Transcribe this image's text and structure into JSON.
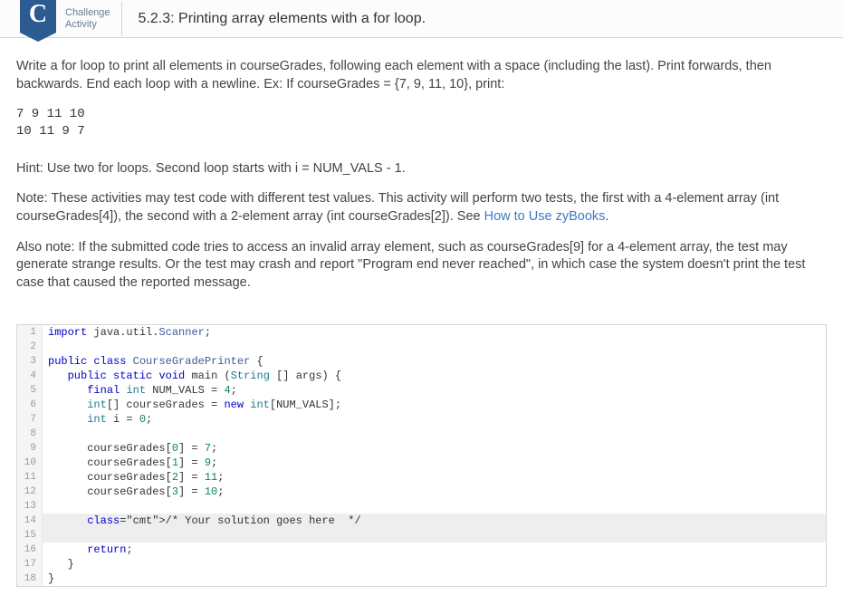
{
  "header": {
    "badge_letter": "C",
    "badge_label_line1": "Challenge",
    "badge_label_line2": "Activity",
    "title": "5.2.3: Printing array elements with a for loop."
  },
  "instructions": {
    "p1": "Write a for loop to print all elements in courseGrades, following each element with a space (including the last). Print forwards, then backwards. End each loop with a newline. Ex: If courseGrades = {7, 9, 11, 10}, print:",
    "example_output": "7 9 11 10\n10 11 9 7",
    "hint": "Hint: Use two for loops. Second loop starts with i = NUM_VALS - 1.",
    "note_prefix": "Note: These activities may test code with different test values. This activity will perform two tests, the first with a 4-element array (int courseGrades[4]), the second with a 2-element array (int courseGrades[2]). See ",
    "note_link": "How to Use zyBooks",
    "note_suffix": ".",
    "also_note": "Also note: If the submitted code tries to access an invalid array element, such as courseGrades[9] for a 4-element array, the test may generate strange results. Or the test may crash and report \"Program end never reached\", in which case the system doesn't print the test case that caused the reported message."
  },
  "code": {
    "lines": [
      {
        "n": "1",
        "t": "import",
        "rest": " java.util.Scanner;"
      },
      {
        "n": "2",
        "blank": true
      },
      {
        "n": "3",
        "raw": "public class CourseGradePrinter {"
      },
      {
        "n": "4",
        "raw": "   public static void main (String [] args) {"
      },
      {
        "n": "5",
        "raw": "      final int NUM_VALS = 4;"
      },
      {
        "n": "6",
        "raw": "      int[] courseGrades = new int[NUM_VALS];"
      },
      {
        "n": "7",
        "raw": "      int i = 0;"
      },
      {
        "n": "8",
        "blank": true
      },
      {
        "n": "9",
        "raw": "      courseGrades[0] = 7;"
      },
      {
        "n": "10",
        "raw": "      courseGrades[1] = 9;"
      },
      {
        "n": "11",
        "raw": "      courseGrades[2] = 11;"
      },
      {
        "n": "12",
        "raw": "      courseGrades[3] = 10;"
      },
      {
        "n": "13",
        "blank": true
      },
      {
        "n": "14",
        "raw": "      /* Your solution goes here  */",
        "hl": true
      },
      {
        "n": "15",
        "blank": true,
        "hl": true
      },
      {
        "n": "16",
        "raw": "      return;"
      },
      {
        "n": "17",
        "raw": "   }"
      },
      {
        "n": "18",
        "raw": "}"
      }
    ]
  }
}
